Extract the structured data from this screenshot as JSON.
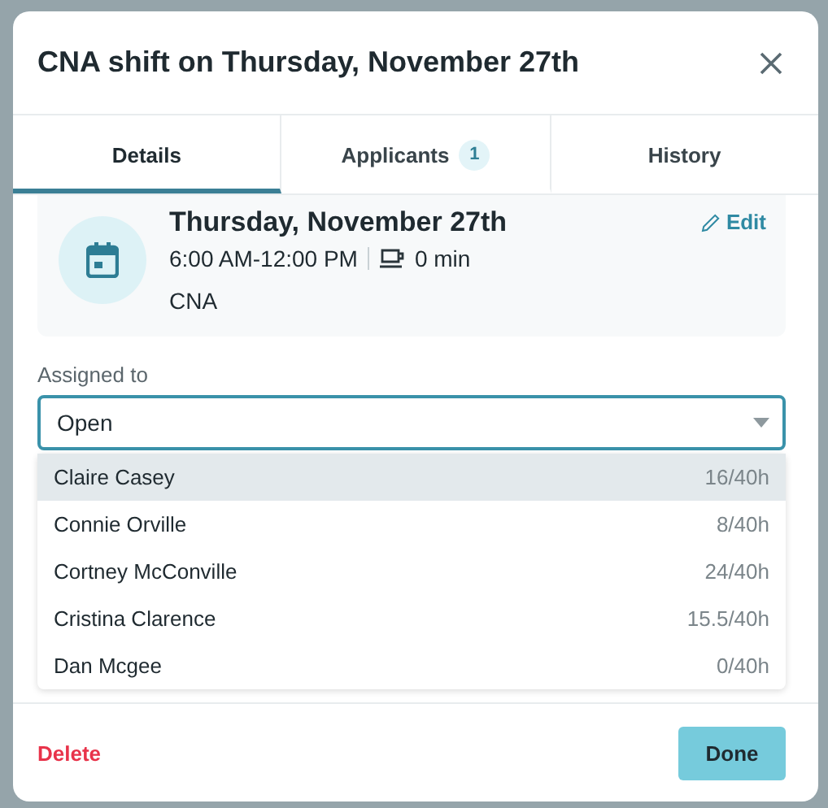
{
  "dialog": {
    "title": "CNA shift on Thursday, November 27th"
  },
  "tabs": [
    {
      "label": "Details",
      "selected": true
    },
    {
      "label": "Applicants",
      "badge": "1",
      "selected": false
    },
    {
      "label": "History",
      "selected": false
    }
  ],
  "shift": {
    "date": "Thursday, November 27th",
    "time": "6:00 AM-12:00 PM",
    "break": "0 min",
    "role": "CNA",
    "edit": "Edit"
  },
  "assigned": {
    "label": "Assigned to",
    "value": "Open"
  },
  "options": [
    {
      "name": "Claire Casey",
      "hours": "16/40h",
      "selected": true
    },
    {
      "name": "Connie Orville",
      "hours": "8/40h",
      "selected": false
    },
    {
      "name": "Cortney McConville",
      "hours": "24/40h",
      "selected": false
    },
    {
      "name": "Cristina Clarence",
      "hours": "15.5/40h",
      "selected": false
    },
    {
      "name": "Dan Mcgee",
      "hours": "0/40h",
      "selected": false
    }
  ],
  "footer": {
    "delete": "Delete",
    "done": "Done"
  }
}
